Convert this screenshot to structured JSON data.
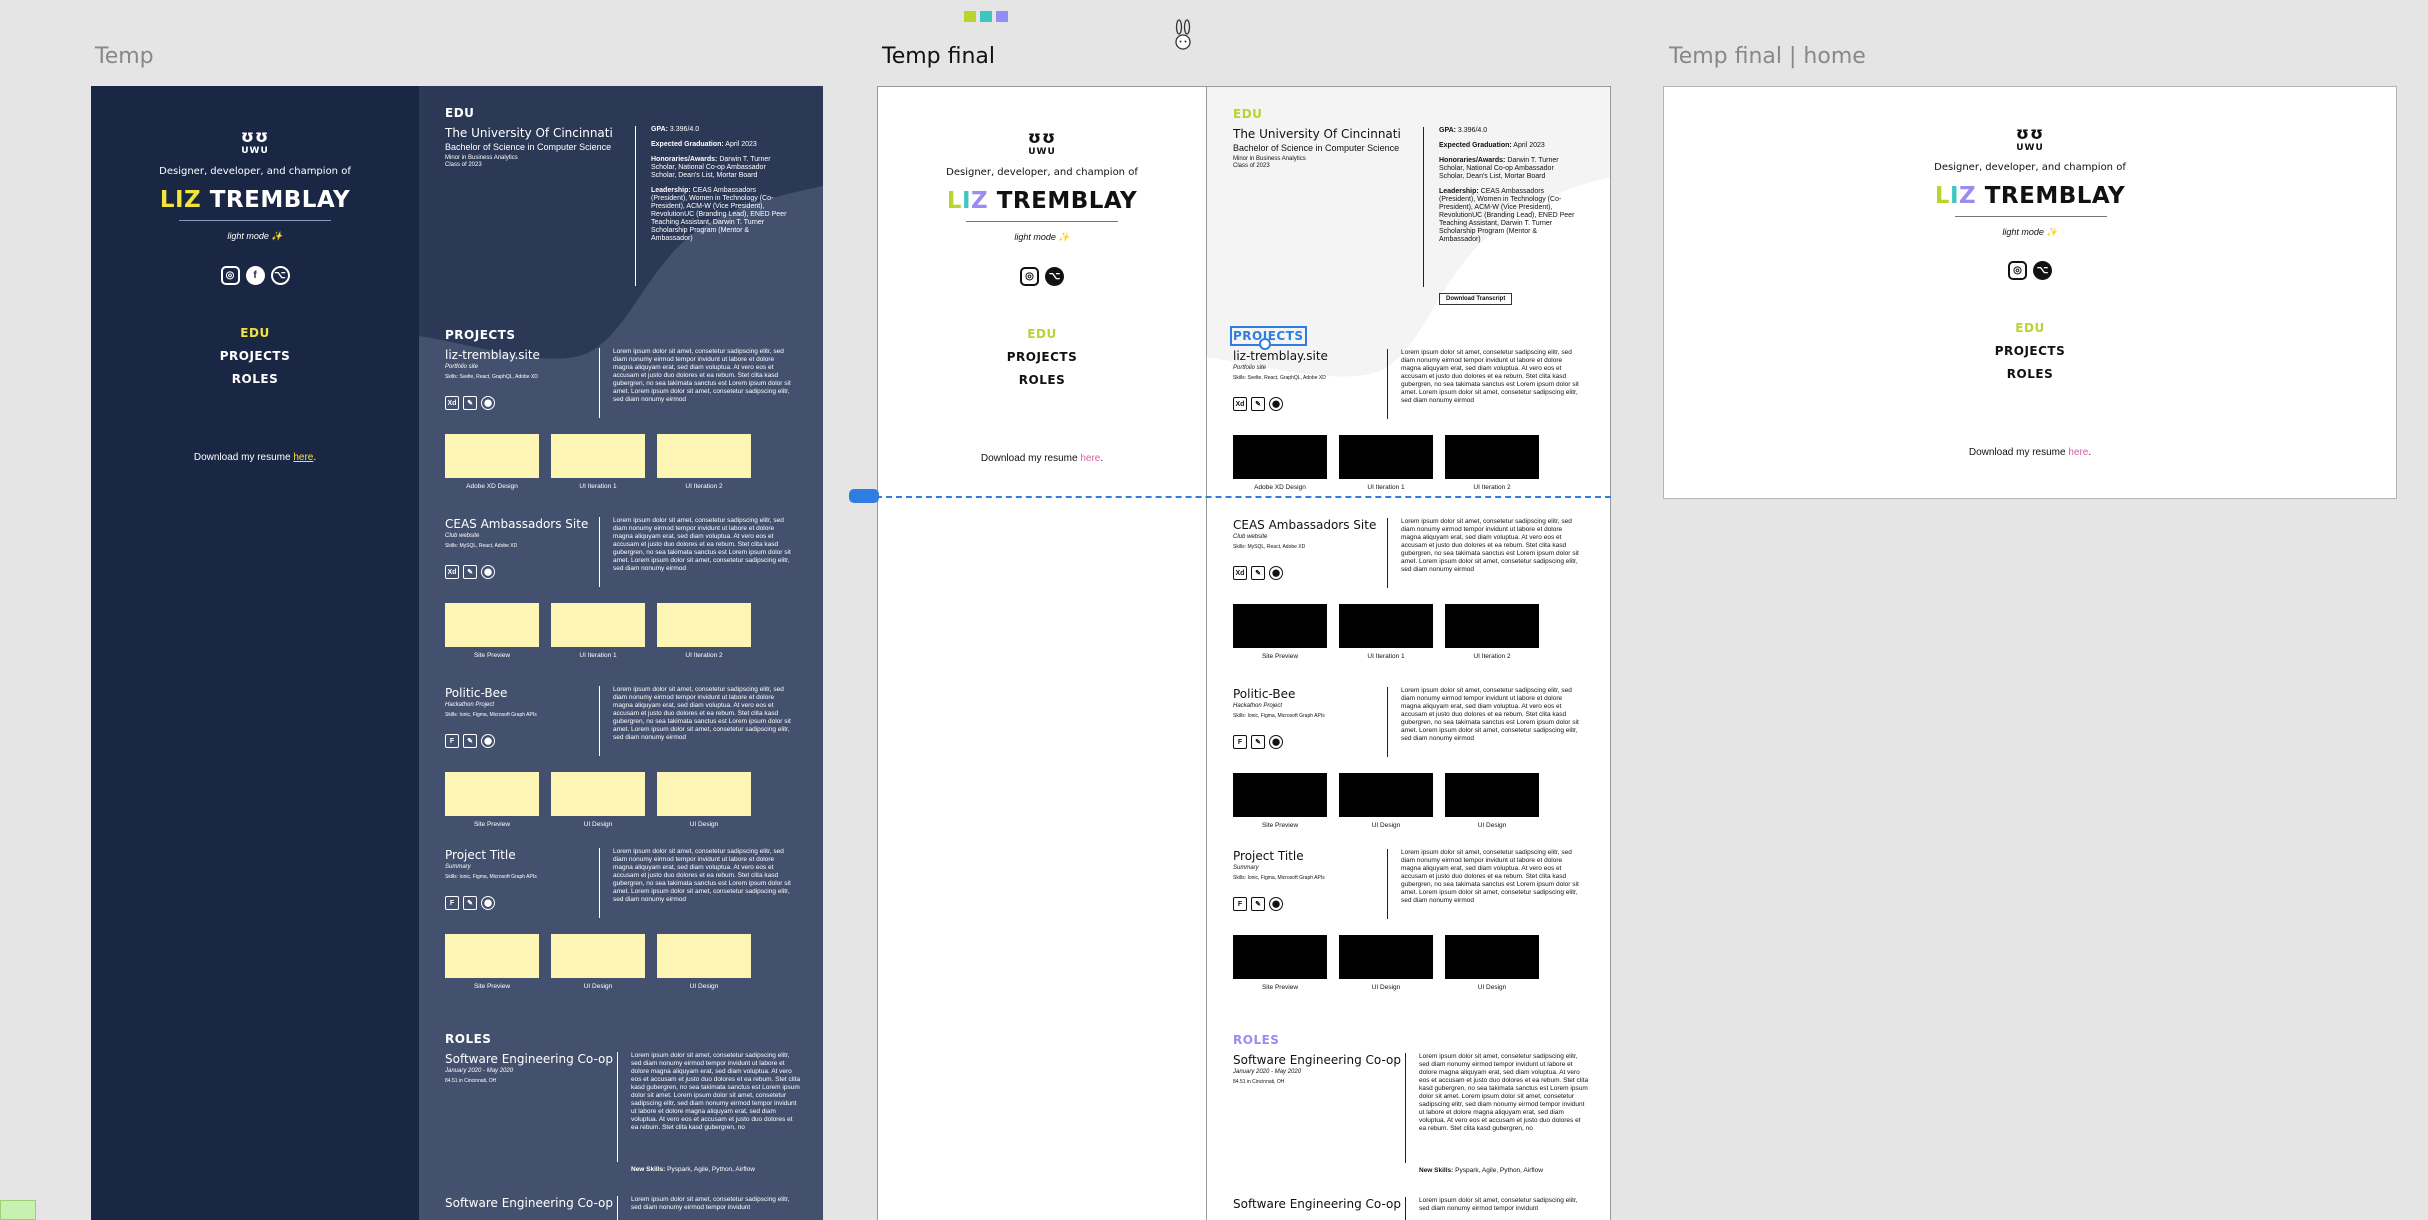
{
  "toolbar": {
    "swatches": [
      "#b6d62f",
      "#3ec6c0",
      "#8f8ff5"
    ],
    "cursor_glyph": "rabbit-cursor-icon"
  },
  "frames": {
    "temp_label": "Temp",
    "final_label": "Temp final",
    "home_label": "Temp final | home"
  },
  "colors": {
    "dark_bg": "#1a2744",
    "dark_right": "#44516e",
    "yellow": "#f4e33a",
    "lime": "#b6d62f",
    "purple": "#9a8cf0",
    "selection": "#2f7de1",
    "pink": "#d462a8",
    "thumb_yellow": "#fcf5b4"
  },
  "profile": {
    "logo": "UWU",
    "tagline": "Designer, developer, and champion of",
    "name_liz": "LIZ",
    "name_rest": "TREMBLAY",
    "mode": "light mode ✨",
    "nav": [
      "EDU",
      "PROJECTS",
      "ROLES"
    ],
    "resume_prefix": "Download my resume ",
    "resume_link": "here",
    "resume_suffix": "."
  },
  "edu": {
    "heading": "EDU",
    "university": "The University Of Cincinnati",
    "degree": "Bachelor of Science in Computer Science",
    "minor": "Minor in Business Analytics",
    "class": "Class of 2023",
    "gpa_label": "GPA:",
    "gpa_value": " 3.396/4.0",
    "grad_label": "Expected Graduation:",
    "grad_value": " April 2023",
    "honors_label": "Honoraries/Awards:",
    "honors_value": " Darwin T. Turner Scholar, National Co-op Ambassador Scholar, Dean's List, Mortar Board",
    "leadership_label": "Leadership:",
    "leadership_value": " CEAS Ambassadors (President), Women in Technology (Co-President), ACM-W (Vice President), RevolutionUC (Branding Lead), ENED Peer Teaching Assistant, Darwin T. Turner Scholarship Program (Mentor & Ambassador)",
    "transcript_button": "Download Transcript"
  },
  "projects_heading": "PROJECTS",
  "projects": [
    {
      "title": "liz-tremblay.site",
      "subtitle": "Portfolio site",
      "skills": "Skills: Svelte, React, GraphQL, Adobe XD",
      "icons": [
        "Xd",
        "✎",
        "⬤"
      ],
      "captions": [
        "Adobe XD Design",
        "UI Iteration 1",
        "UI Iteration 2"
      ]
    },
    {
      "title": "CEAS Ambassadors Site",
      "subtitle": "Club website",
      "skills": "Skills: MySQL, React, Adobe XD",
      "icons": [
        "Xd",
        "✎",
        "⬤"
      ],
      "captions": [
        "Site Preview",
        "UI Iteration 1",
        "UI Iteration 2"
      ]
    },
    {
      "title": "Politic-Bee",
      "subtitle": "Hackathon Project",
      "skills": "Skills: Ionic, Figma, Microsoft Graph APIs",
      "icons": [
        "F",
        "✎",
        "⬤"
      ],
      "captions": [
        "Site Preview",
        "UI Design",
        "UI Design"
      ]
    },
    {
      "title": "Project Title",
      "subtitle": "Summary",
      "skills": "Skills: Ionic, Figma, Microsoft Graph APIs",
      "icons": [
        "F",
        "✎",
        "⬤"
      ],
      "captions": [
        "Site Preview",
        "UI Design",
        "UI Design"
      ]
    }
  ],
  "lorem": "Lorem ipsum dolor sit amet, consetetur sadipscing elitr, sed diam nonumy eirmod tempor invidunt ut labore et dolore magna aliquyam erat, sed diam voluptua. At vero eos et accusam et justo duo dolores et ea rebum. Stet clita kasd gubergren, no sea takimata sanctus est Lorem ipsum dolor sit amet. Lorem ipsum dolor sit amet, consetetur sadipscing elitr, sed diam nonumy eirmod",
  "roles_heading": "ROLES",
  "roles": [
    {
      "title": "Software Engineering Co-op",
      "date": "January 2020 - May 2020",
      "location": "84.51 in Cincinnati, OH",
      "desc": "Lorem ipsum dolor sit amet, consetetur sadipscing elitr, sed diam nonumy eirmod tempor invidunt ut labore et dolore magna aliquyam erat, sed diam voluptua. At vero eos et accusam et justo duo dolores et ea rebum. Stet clita kasd gubergren, no sea takimata sanctus est Lorem ipsum dolor sit amet. Lorem ipsum dolor sit amet, consetetur sadipscing elitr, sed diam nonumy eirmod tempor invidunt ut labore et dolore magna aliquyam erat, sed diam voluptua. At vero eos et accusam et justo duo dolores et ea rebum. Stet clita kasd gubergren, no",
      "skills_label": "New Skills:",
      "skills_value": " Pyspark, Agile, Python, Airflow"
    },
    {
      "title": "Software Engineering Co-op",
      "desc": "Lorem ipsum dolor sit amet, consetetur sadipscing elitr, sed diam nonumy eirmod tempor invidunt"
    }
  ]
}
